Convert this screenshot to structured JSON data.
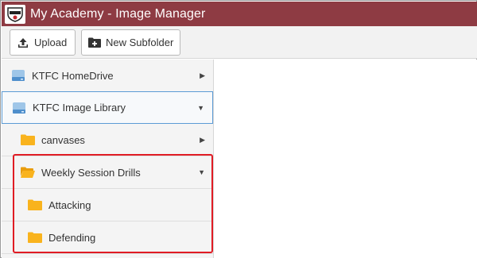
{
  "window": {
    "title": "My Academy - Image Manager",
    "logo_icon": "academy-crest-logo"
  },
  "toolbar": {
    "upload_label": "Upload",
    "upload_icon": "upload-icon",
    "new_subfolder_label": "New Subfolder",
    "new_subfolder_icon": "folder-plus-icon"
  },
  "sidebar": {
    "items": [
      {
        "label": "KTFC HomeDrive",
        "icon": "drive-icon",
        "expanded": false,
        "level": 0
      },
      {
        "label": "KTFC Image Library",
        "icon": "drive-icon",
        "expanded": true,
        "selected": true,
        "level": 0
      },
      {
        "label": "canvases",
        "icon": "folder-icon",
        "expanded": false,
        "level": 1
      },
      {
        "label": "Weekly Session Drills",
        "icon": "folder-open-icon",
        "expanded": true,
        "level": 1
      },
      {
        "label": "Attacking",
        "icon": "folder-icon",
        "level": 2
      },
      {
        "label": "Defending",
        "icon": "folder-icon",
        "level": 2
      }
    ],
    "chevron_collapsed": "▶",
    "chevron_expanded": "▼"
  },
  "colors": {
    "titlebar": "#8e3b43",
    "folder": "#f9b31d",
    "highlight": "#e01c24",
    "selected_border": "#5b9bd5"
  }
}
